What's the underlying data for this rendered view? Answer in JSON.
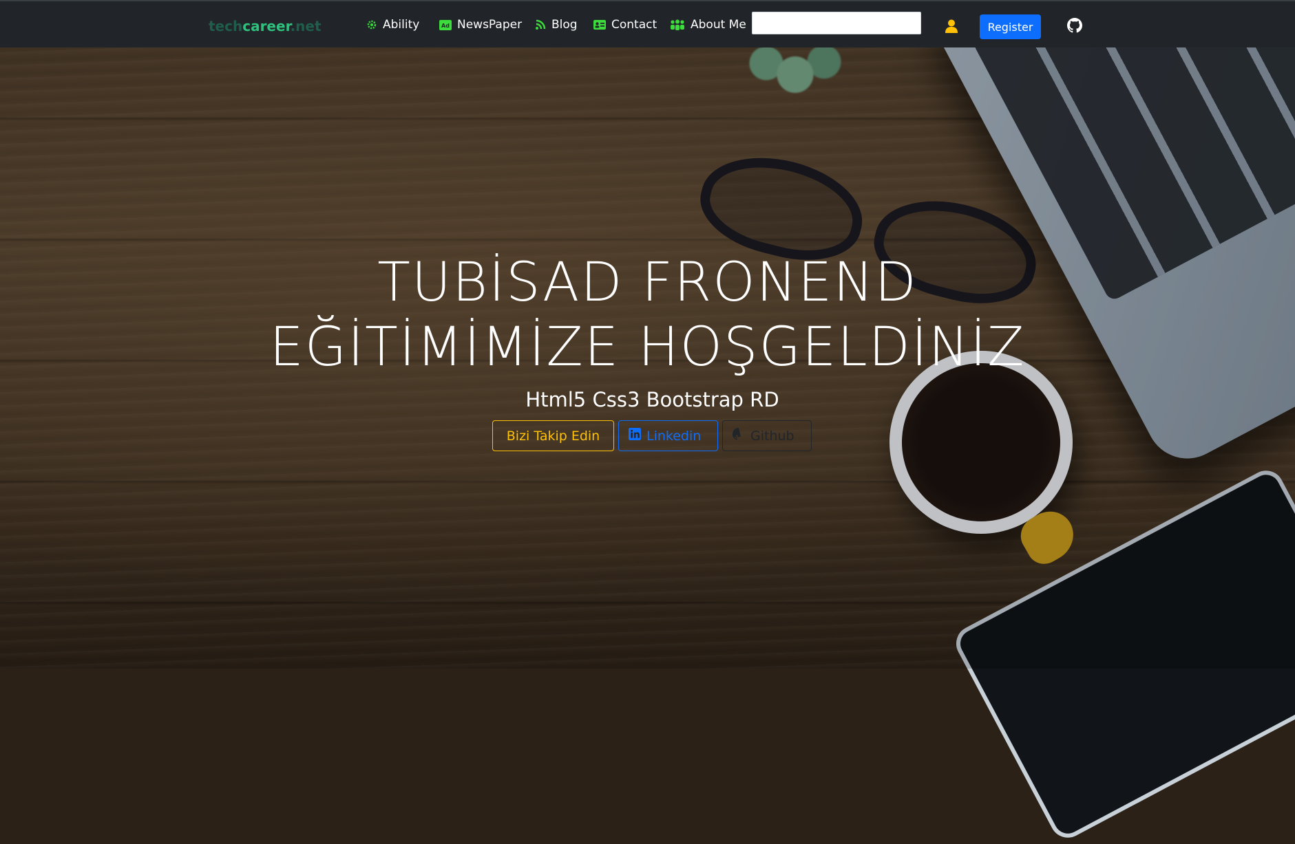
{
  "brand": {
    "part1": "tech",
    "part2": "career",
    "part3": ".net"
  },
  "nav": {
    "items": [
      {
        "label": "Ability",
        "icon": "gear-icon"
      },
      {
        "label": "NewsPaper",
        "icon": "ad-icon"
      },
      {
        "label": "Blog",
        "icon": "blog-icon"
      },
      {
        "label": "Contact",
        "icon": "contact-card-icon"
      },
      {
        "label": "About Me",
        "icon": "users-icon"
      }
    ],
    "search_value": "",
    "register_label": "Register"
  },
  "hero": {
    "title_line1": "TUBİSAD FRONEND",
    "title_line2": "EĞİTİMİMİZE HOŞGELDİNİZ",
    "subtitle": "Html5 Css3 Bootstrap RD",
    "buttons": {
      "follow": "Bizi Takip Edin",
      "linkedin": "Linkedin",
      "github": "Github"
    }
  },
  "colors": {
    "nav_bg": "#212529",
    "nav_icon": "#3bdc3b",
    "primary": "#0d6efd",
    "warning": "#ffc107",
    "dark": "#212529",
    "brand_accent": "#2ec27e"
  }
}
